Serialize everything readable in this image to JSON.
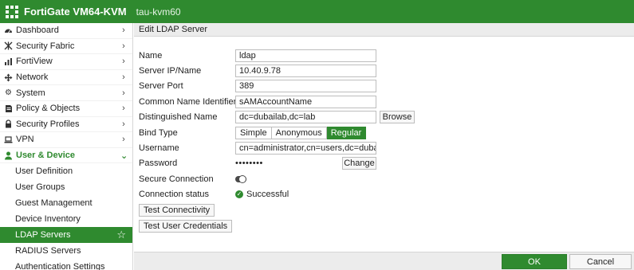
{
  "header": {
    "product": "FortiGate VM64-KVM",
    "hostname": "tau-kvm60",
    "brand_color": "#2f8a2f"
  },
  "sidebar": {
    "items": [
      {
        "label": "Dashboard",
        "icon": "dashboard-icon"
      },
      {
        "label": "Security Fabric",
        "icon": "fabric-icon"
      },
      {
        "label": "FortiView",
        "icon": "fortiview-icon"
      },
      {
        "label": "Network",
        "icon": "network-icon"
      },
      {
        "label": "System",
        "icon": "gear-icon"
      },
      {
        "label": "Policy & Objects",
        "icon": "policy-icon"
      },
      {
        "label": "Security Profiles",
        "icon": "lock-icon"
      },
      {
        "label": "VPN",
        "icon": "laptop-icon"
      },
      {
        "label": "User & Device",
        "icon": "user-icon"
      }
    ],
    "sub_items": [
      {
        "label": "User Definition"
      },
      {
        "label": "User Groups"
      },
      {
        "label": "Guest Management"
      },
      {
        "label": "Device Inventory"
      },
      {
        "label": "LDAP Servers"
      },
      {
        "label": "RADIUS Servers"
      },
      {
        "label": "Authentication Settings"
      }
    ]
  },
  "panel": {
    "title": "Edit LDAP Server"
  },
  "form": {
    "name_label": "Name",
    "name_value": "ldap",
    "server_label": "Server IP/Name",
    "server_value": "10.40.9.78",
    "port_label": "Server Port",
    "port_value": "389",
    "cn_label": "Common Name Identifier",
    "cn_value": "sAMAccountName",
    "dn_label": "Distinguished Name",
    "dn_value": "dc=dubailab,dc=lab",
    "browse_label": "Browse",
    "bind_label": "Bind Type",
    "bind_options": [
      "Simple",
      "Anonymous",
      "Regular"
    ],
    "bind_selected": "Regular",
    "username_label": "Username",
    "username_value": "cn=administrator,cn=users,dc=dubailab",
    "password_label": "Password",
    "password_value": "••••••••",
    "change_label": "Change",
    "secure_label": "Secure Connection",
    "secure_enabled": false,
    "status_label": "Connection status",
    "status_value": "Successful",
    "test_connectivity_label": "Test Connectivity",
    "test_credentials_label": "Test User Credentials"
  },
  "footer": {
    "ok_label": "OK",
    "cancel_label": "Cancel"
  }
}
